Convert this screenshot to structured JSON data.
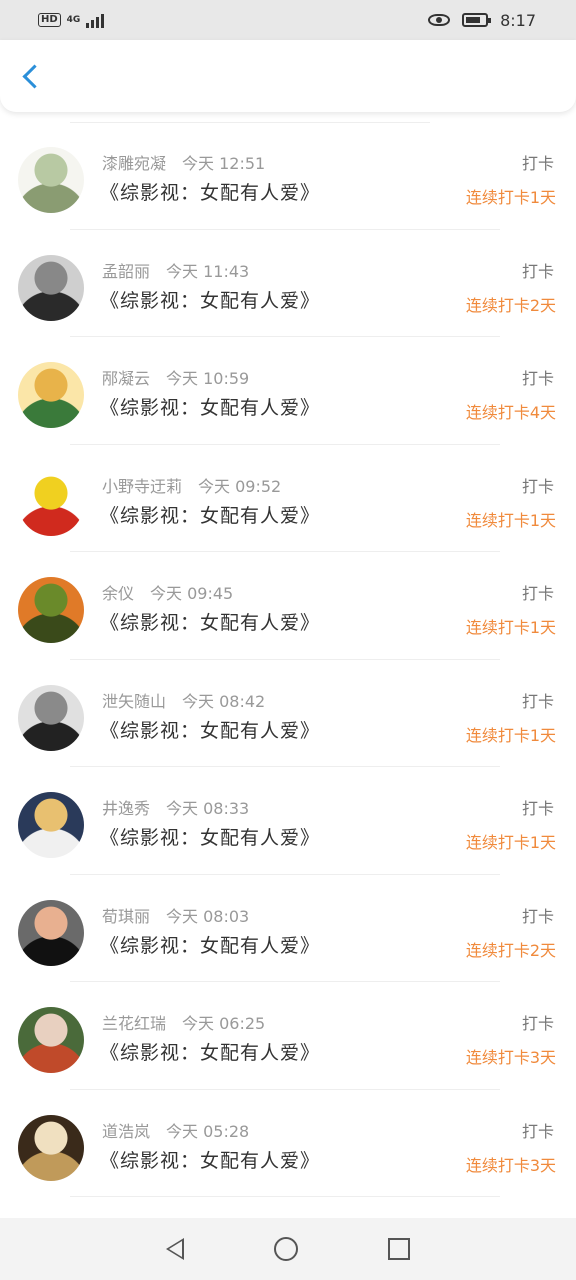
{
  "status": {
    "network_label": "HD",
    "network_type": "4G",
    "time": "8:17"
  },
  "header": {
    "back_icon": "chevron-left-icon",
    "accent": "#2b8fd9"
  },
  "items": [
    {
      "name": "漆雕宛凝",
      "time": "今天 12:51",
      "title": "《综影视：女配有人爱》",
      "action": "打卡",
      "streak": "连续打卡1天",
      "avatar": [
        "#f5f5f0",
        "#b8c9a3",
        "#8a9c72"
      ]
    },
    {
      "name": "孟韶丽",
      "time": "今天 11:43",
      "title": "《综影视：女配有人爱》",
      "action": "打卡",
      "streak": "连续打卡2天",
      "avatar": [
        "#cfcfcf",
        "#888888",
        "#2a2a2a"
      ]
    },
    {
      "name": "邴凝云",
      "time": "今天 10:59",
      "title": "《综影视：女配有人爱》",
      "action": "打卡",
      "streak": "连续打卡4天",
      "avatar": [
        "#fbe6a8",
        "#e8b34a",
        "#3a7a3a"
      ]
    },
    {
      "name": "小野寺迂莉",
      "time": "今天 09:52",
      "title": "《综影视：女配有人爱》",
      "action": "打卡",
      "streak": "连续打卡1天",
      "avatar": [
        "#ffffff",
        "#f0d020",
        "#d02a1e"
      ]
    },
    {
      "name": "余仪",
      "time": "今天 09:45",
      "title": "《综影视：女配有人爱》",
      "action": "打卡",
      "streak": "连续打卡1天",
      "avatar": [
        "#e07a28",
        "#6a8a2a",
        "#3a4a1a"
      ]
    },
    {
      "name": "泄矢随山",
      "time": "今天 08:42",
      "title": "《综影视：女配有人爱》",
      "action": "打卡",
      "streak": "连续打卡1天",
      "avatar": [
        "#e0e0e0",
        "#8a8a8a",
        "#222222"
      ]
    },
    {
      "name": "井逸秀",
      "time": "今天 08:33",
      "title": "《综影视：女配有人爱》",
      "action": "打卡",
      "streak": "连续打卡1天",
      "avatar": [
        "#2a3a5a",
        "#e8c070",
        "#f0f0f0"
      ]
    },
    {
      "name": "荀琪丽",
      "time": "今天 08:03",
      "title": "《综影视：女配有人爱》",
      "action": "打卡",
      "streak": "连续打卡2天",
      "avatar": [
        "#6a6a6a",
        "#e8b090",
        "#111111"
      ]
    },
    {
      "name": "兰花红瑞",
      "time": "今天 06:25",
      "title": "《综影视：女配有人爱》",
      "action": "打卡",
      "streak": "连续打卡3天",
      "avatar": [
        "#4a6a3a",
        "#e8d0c0",
        "#c04a2a"
      ]
    },
    {
      "name": "道浩岚",
      "time": "今天 05:28",
      "title": "《综影视：女配有人爱》",
      "action": "打卡",
      "streak": "连续打卡3天",
      "avatar": [
        "#3a2a1a",
        "#f0e0c0",
        "#c09a5a"
      ]
    }
  ],
  "colors": {
    "streak": "#f08a3c",
    "name": "#999999",
    "title": "#333333"
  },
  "navbar": {
    "icons": [
      "nav-back-icon",
      "nav-home-icon",
      "nav-recent-icon"
    ]
  }
}
